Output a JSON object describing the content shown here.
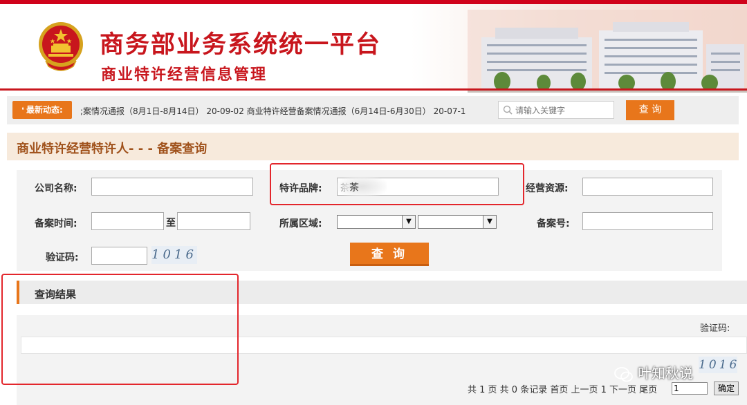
{
  "header": {
    "title": "商务部业务系统统一平台",
    "subtitle": "商业特许经营信息管理"
  },
  "news": {
    "tag_label": "最新动态:",
    "ticker": ";案情况通报（8月1日-8月14日） 20-09-02  商业特许经营备案情况通报（6月14日-6月30日） 20-07-1",
    "search_placeholder": "请输入关键字",
    "search_button": "查 询"
  },
  "page": {
    "title": "商业特许经营特许人- - - 备案查询"
  },
  "form": {
    "company_label": "公司名称:",
    "company_value": "",
    "brand_label": "特许品牌:",
    "brand_value": "茶",
    "resource_label": "经营资源:",
    "resource_value": "",
    "date_label": "备案时间:",
    "date_separator": "至",
    "date_from": "",
    "date_to": "",
    "region_label": "所属区域:",
    "region_value_1": "",
    "region_value_2": "",
    "record_no_label": "备案号:",
    "record_no_value": "",
    "captcha_label": "验证码:",
    "captcha_value": "",
    "captcha_image_text": "1016",
    "query_button": "查 询"
  },
  "results": {
    "title": "查询结果",
    "captcha_label": "验证码:",
    "captcha_image_text": "1016",
    "pager_text": "共 1 页 共 0 条记录 首页 上一页 1 下一页 尾页",
    "pager_input_value": "1",
    "pager_confirm": "确定"
  },
  "watermark": {
    "text": "叶知秋说"
  },
  "colors": {
    "brand_red": "#c8161d",
    "accent_orange": "#e8761b",
    "highlight_box": "#e3262c"
  }
}
